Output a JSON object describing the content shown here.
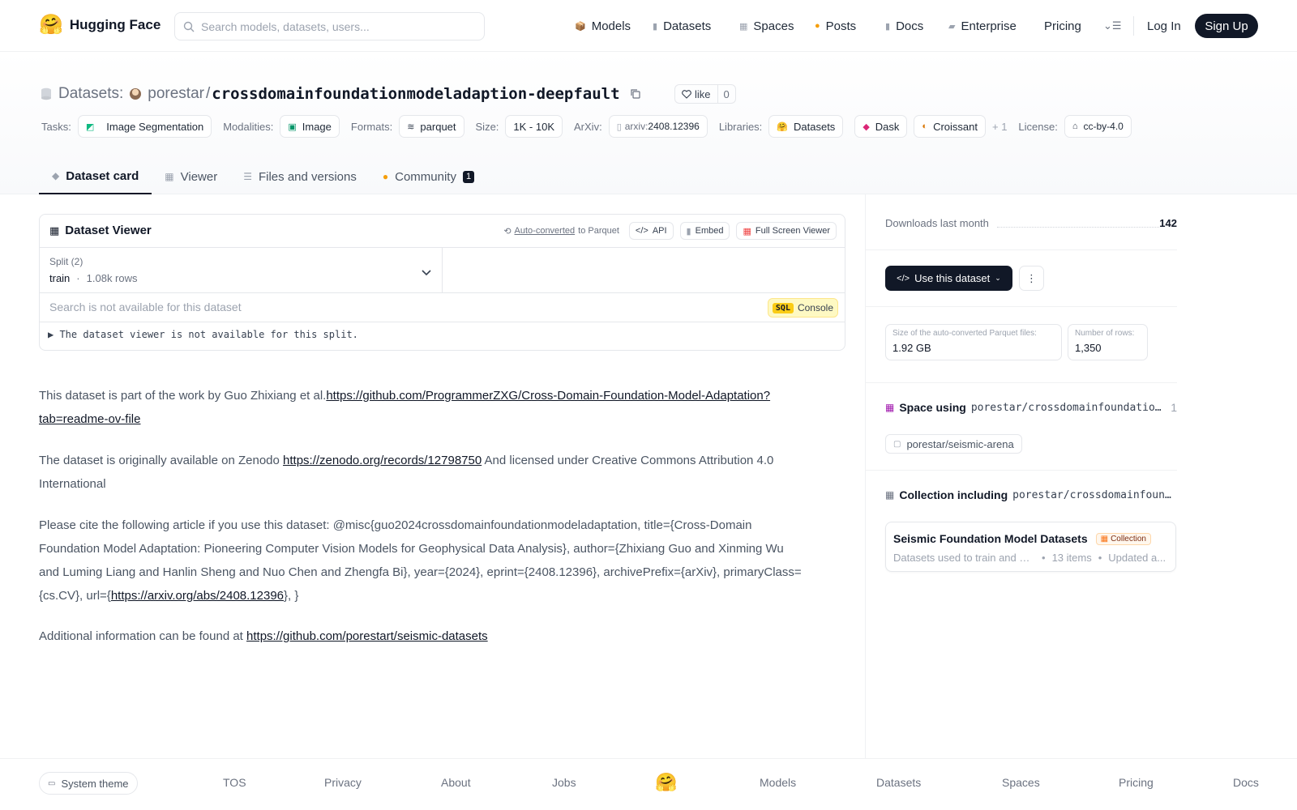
{
  "header": {
    "logo_emoji": "🤗",
    "logo_text": "Hugging Face",
    "search_placeholder": "Search models, datasets, users...",
    "nav": [
      {
        "icon": "📦",
        "label": "Models"
      },
      {
        "icon": "▮",
        "label": "Datasets"
      },
      {
        "icon": "▦",
        "label": "Spaces"
      },
      {
        "icon": "●",
        "label": "Posts"
      },
      {
        "icon": "▮",
        "label": "Docs"
      },
      {
        "icon": "▰",
        "label": "Enterprise"
      },
      {
        "icon": "",
        "label": "Pricing"
      }
    ],
    "menu_icon": "⌄☰",
    "login": "Log In",
    "signup": "Sign Up"
  },
  "repo": {
    "section": "Datasets:",
    "owner": "porestar",
    "slash": "/",
    "name": "crossdomainfoundationmodeladaption-deepfault",
    "like_label": "like",
    "like_count": "0"
  },
  "tags": {
    "tasks_label": "Tasks:",
    "task": "Image Segmentation",
    "modalities_label": "Modalities:",
    "modality": "Image",
    "formats_label": "Formats:",
    "format": "parquet",
    "size_label": "Size:",
    "size": "1K - 10K",
    "arxiv_label": "ArXiv:",
    "arxiv_prefix": "arxiv:",
    "arxiv_id": "2408.12396",
    "libraries_label": "Libraries:",
    "libraries": [
      "Datasets",
      "Dask",
      "Croissant"
    ],
    "libraries_more": "+ 1",
    "license_label": "License:",
    "license": "cc-by-4.0"
  },
  "tabs": [
    {
      "label": "Dataset card"
    },
    {
      "label": "Viewer"
    },
    {
      "label": "Files and versions"
    },
    {
      "label": "Community",
      "badge": "1"
    }
  ],
  "viewer": {
    "title": "Dataset Viewer",
    "auto_converted": "Auto-converted",
    "to_parquet": "to Parquet",
    "api": "API",
    "embed": "Embed",
    "fullscreen": "Full Screen Viewer",
    "split_label": "Split (2)",
    "split_value": "train",
    "split_dot": "·",
    "split_rows": "1.08k rows",
    "search_placeholder": "Search is not available for this dataset",
    "sql_tag": "SQL",
    "console": "Console",
    "not_available": "▶ The dataset viewer is not available for this split."
  },
  "card": {
    "p1_text": "This dataset is part of the work by Guo Zhixiang et al.",
    "p1_link": "https://github.com/ProgrammerZXG/Cross-Domain-Foundation-Model-Adaptation?tab=readme-ov-file",
    "p2_text_a": "The dataset is originally available on Zenodo ",
    "p2_link": "https://zenodo.org/records/12798750",
    "p2_text_b": " And licensed under Creative Commons Attribution 4.0 International",
    "p3_text_a": "Please cite the following article if you use this dataset: @misc{guo2024crossdomainfoundationmodeladaptation, title={Cross-Domain Foundation Model Adaptation: Pioneering Computer Vision Models for Geophysical Data Analysis}, author={Zhixiang Guo and Xinming Wu and Luming Liang and Hanlin Sheng and Nuo Chen and Zhengfa Bi}, year={2024}, eprint={2408.12396}, archivePrefix={arXiv}, primaryClass={cs.CV}, url={",
    "p3_link": "https://arxiv.org/abs/2408.12396",
    "p3_text_b": "}, }",
    "p4_text": "Additional information can be found at ",
    "p4_link": "https://github.com/porestart/seismic-datasets"
  },
  "sidebar": {
    "downloads_label": "Downloads last month",
    "downloads_value": "142",
    "use_dataset": "Use this dataset",
    "parquet_size_label": "Size of the auto-converted Parquet files:",
    "parquet_size_value": "1.92 GB",
    "rows_label": "Number of rows:",
    "rows_value": "1,350",
    "space_heading": "Space using",
    "space_repo": "porestar/crossdomainfoundationmodeladaption-deepfault",
    "space_count": "1",
    "space_chip": "porestar/seismic-arena",
    "collection_heading": "Collection including",
    "collection_repo": "porestar/crossdomainfoundationmodeladaption-deepfault",
    "collection_title": "Seismic Foundation Model Datasets",
    "collection_tag": "Collection",
    "collection_desc": "Datasets used to train and evaluate",
    "collection_items": "13 items",
    "collection_updated": "Updated a..."
  },
  "footer": {
    "theme": "System theme",
    "links": [
      "TOS",
      "Privacy",
      "About",
      "Jobs",
      "Models",
      "Datasets",
      "Spaces",
      "Pricing",
      "Docs"
    ],
    "logo_emoji": "🤗"
  },
  "colors": {
    "primary_dark": "#111827",
    "muted_text": "#6b7280",
    "border": "#e5e7eb",
    "sql_yellow": "#facc15"
  }
}
